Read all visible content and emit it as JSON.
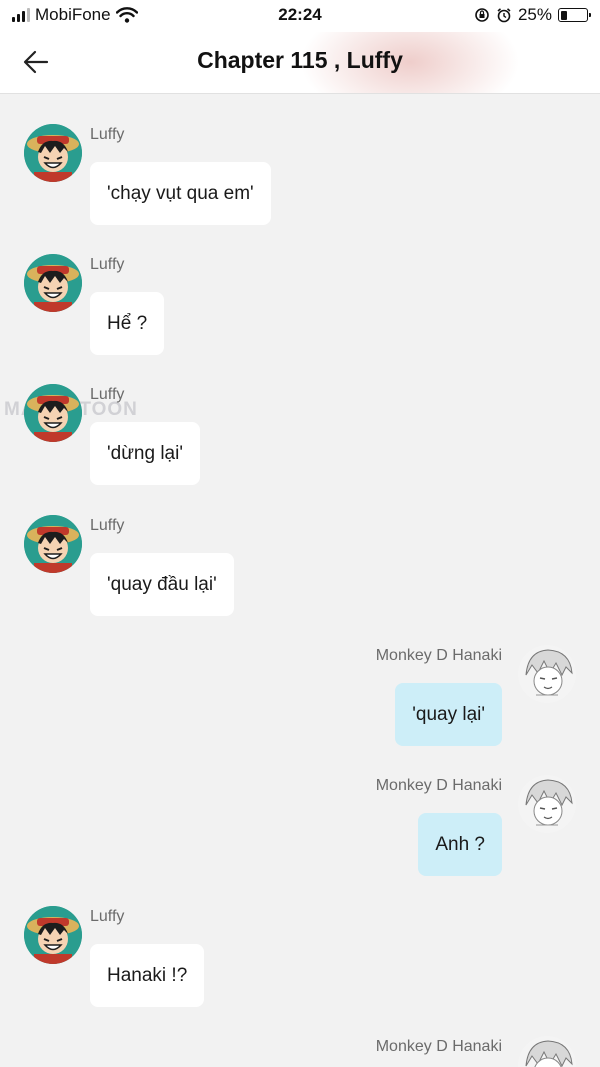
{
  "status_bar": {
    "carrier": "MobiFone",
    "time": "22:24",
    "battery_percent": "25%",
    "battery_level": 0.25,
    "icons": [
      "signal-bars-icon",
      "wifi-icon",
      "orientation-lock-icon",
      "alarm-icon",
      "battery-icon"
    ]
  },
  "header": {
    "title": "Chapter 115 , Luffy",
    "back_icon": "arrow-left-icon"
  },
  "watermark": "MANGATOON",
  "messages": [
    {
      "side": "left",
      "sender": "Luffy",
      "text": "'chạy vụt qua em'"
    },
    {
      "side": "left",
      "sender": "Luffy",
      "text": "Hể ?"
    },
    {
      "side": "left",
      "sender": "Luffy",
      "text": "'dừng lại'"
    },
    {
      "side": "left",
      "sender": "Luffy",
      "text": "'quay đầu lại'"
    },
    {
      "side": "right",
      "sender": "Monkey D Hanaki",
      "text": "'quay lại'"
    },
    {
      "side": "right",
      "sender": "Monkey D Hanaki",
      "text": "Anh ?"
    },
    {
      "side": "left",
      "sender": "Luffy",
      "text": "Hanaki !?"
    },
    {
      "side": "right",
      "sender": "Monkey D Hanaki",
      "text": ""
    }
  ],
  "colors": {
    "background": "#f2f2f2",
    "left_bubble": "#ffffff",
    "right_bubble": "#cdeef8",
    "sender_text": "#6b6b6b"
  }
}
